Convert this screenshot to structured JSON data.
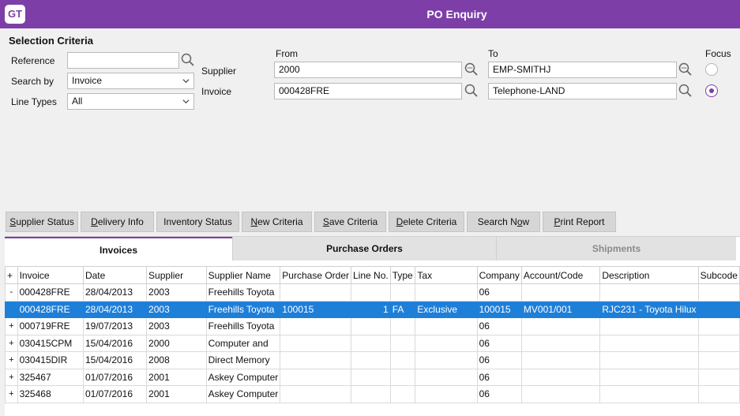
{
  "app": {
    "logo": "GT",
    "title": "PO Enquiry"
  },
  "criteria": {
    "section_title": "Selection Criteria",
    "reference_label": "Reference",
    "reference_value": "",
    "search_by_label": "Search by",
    "search_by_value": "Invoice",
    "line_types_label": "Line Types",
    "line_types_value": "All",
    "from_label": "From",
    "to_label": "To",
    "focus_label": "Focus",
    "supplier_label": "Supplier",
    "supplier_from": "2000",
    "supplier_to": "EMP-SMITHJ",
    "invoice_label": "Invoice",
    "invoice_from": "000428FRE",
    "invoice_to": "Telephone-LAND",
    "focus_selected": "invoice"
  },
  "toolbar": {
    "supplier_status": {
      "pre": "",
      "u": "S",
      "post": "upplier Status"
    },
    "delivery_info": {
      "pre": "",
      "u": "D",
      "post": "elivery Info"
    },
    "inventory_status": {
      "pre": "",
      "u": "",
      "post": "Inventory Status"
    },
    "new_criteria": {
      "pre": "",
      "u": "N",
      "post": "ew Criteria"
    },
    "save_criteria": {
      "pre": "",
      "u": "S",
      "post": "ave Criteria"
    },
    "delete_criteria": {
      "pre": "",
      "u": "D",
      "post": "elete Criteria"
    },
    "search_now": {
      "pre": "Search N",
      "u": "o",
      "post": "w"
    },
    "print_report": {
      "pre": "",
      "u": "P",
      "post": "rint Report"
    }
  },
  "tabs": [
    "Invoices",
    "Purchase Orders",
    "Shipments"
  ],
  "grid": {
    "columns": [
      "+",
      "Invoice",
      "Date",
      "Supplier",
      "Supplier Name",
      "Purchase Order",
      "Line No.",
      "Type",
      "Tax",
      "Company",
      "Account/Code",
      "Description",
      "Subcode"
    ],
    "rows": [
      [
        "-",
        "000428FRE",
        "28/04/2013",
        "2003",
        "Freehills Toyota",
        "",
        "",
        "",
        "",
        "06",
        "",
        "",
        ""
      ],
      [
        "",
        "000428FRE",
        "28/04/2013",
        "2003",
        "Freehills Toyota",
        "100015",
        "1",
        "FA",
        "Exclusive",
        "100015",
        "MV001/001",
        "RJC231 - Toyota Hilux",
        ""
      ],
      [
        "+",
        "000719FRE",
        "19/07/2013",
        "2003",
        "Freehills Toyota",
        "",
        "",
        "",
        "",
        "06",
        "",
        "",
        ""
      ],
      [
        "+",
        "030415CPM",
        "15/04/2016",
        "2000",
        "Computer and",
        "",
        "",
        "",
        "",
        "06",
        "",
        "",
        ""
      ],
      [
        "+",
        "030415DIR",
        "15/04/2016",
        "2008",
        "Direct Memory",
        "",
        "",
        "",
        "",
        "06",
        "",
        "",
        ""
      ],
      [
        "+",
        "325467",
        "01/07/2016",
        "2001",
        "Askey Computer",
        "",
        "",
        "",
        "",
        "06",
        "",
        "",
        ""
      ],
      [
        "+",
        "325468",
        "01/07/2016",
        "2001",
        "Askey Computer",
        "",
        "",
        "",
        "",
        "06",
        "",
        "",
        ""
      ]
    ],
    "selected_row": 1
  }
}
